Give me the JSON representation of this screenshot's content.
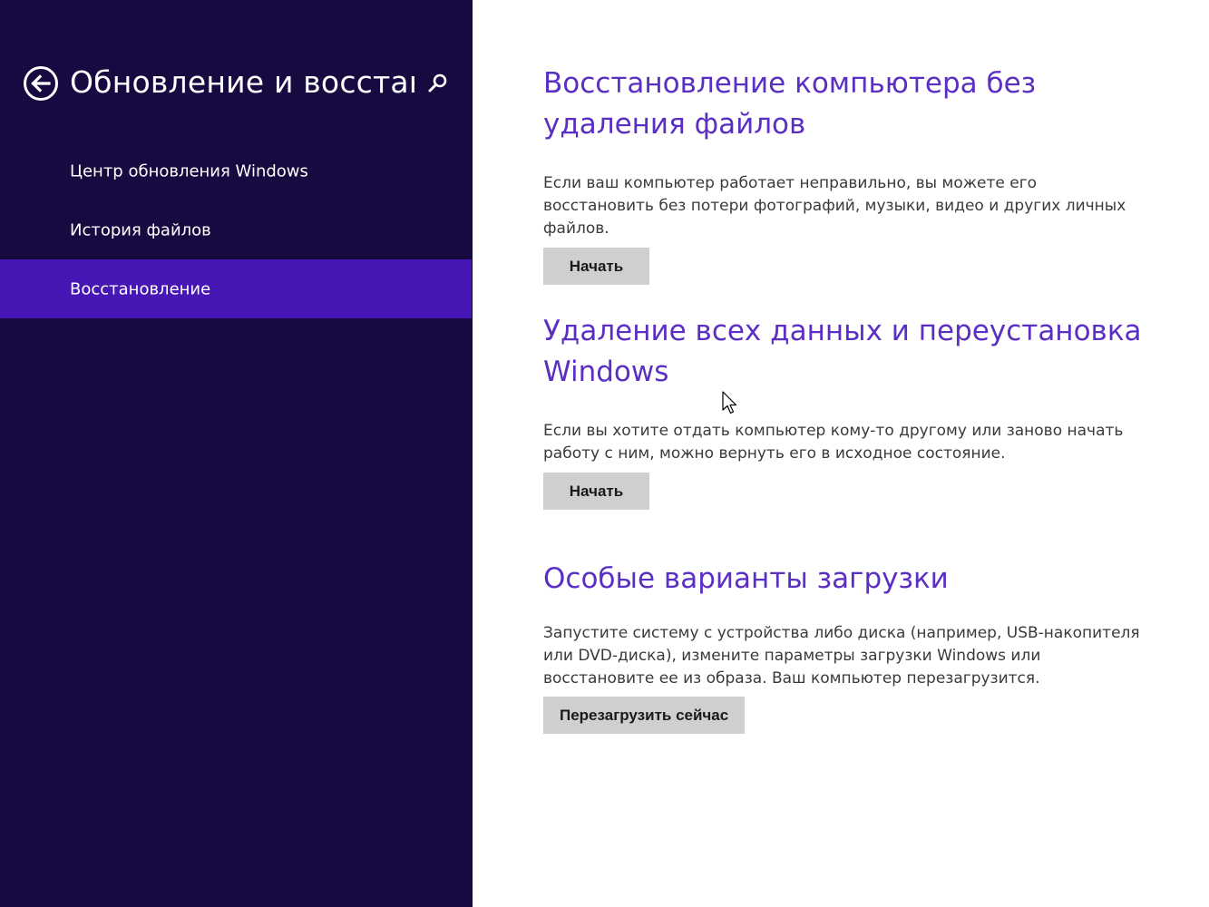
{
  "sidebar": {
    "title": "Обновление и восстан…",
    "back_icon": "back-arrow-icon",
    "search_icon": "search-icon",
    "items": [
      {
        "label": "Центр обновления Windows",
        "selected": false
      },
      {
        "label": "История файлов",
        "selected": false
      },
      {
        "label": "Восстановление",
        "selected": true
      }
    ]
  },
  "main": {
    "sections": [
      {
        "title": "Восстановление компьютера без удаления файлов",
        "description": "Если ваш компьютер работает неправильно, вы можете его восстановить без потери фотографий, музыки, видео и других личных файлов.",
        "button": "Начать"
      },
      {
        "title": "Удаление всех данных и переустановка Windows",
        "description": "Если вы хотите отдать компьютер кому-то другому или заново начать работу с ним, можно вернуть его в исходное состояние.",
        "button": "Начать"
      },
      {
        "title": "Особые варианты загрузки",
        "description": "Запустите систему с устройства либо диска (например, USB-накопителя или DVD-диска), измените параметры загрузки Windows или восстановите ее из образа. Ваш компьютер перезагрузится.",
        "button": "Перезагрузить сейчас"
      }
    ]
  },
  "colors": {
    "sidebar_bg": "#160a40",
    "selected_bg": "#4617b4",
    "heading": "#5b2fc4",
    "button_bg": "#cfcfcf"
  }
}
